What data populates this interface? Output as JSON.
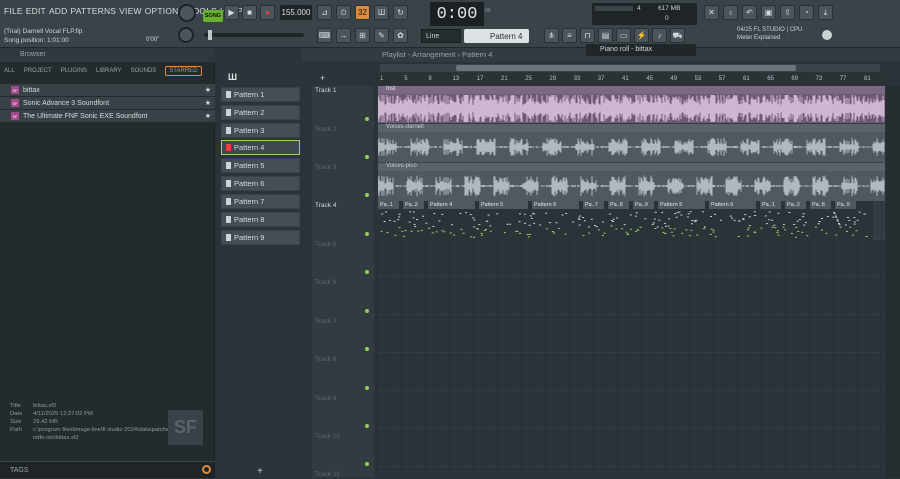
{
  "menu": [
    "FILE",
    "EDIT",
    "ADD",
    "PATTERNS",
    "VIEW",
    "OPTIONS",
    "TOOLS",
    "HELP"
  ],
  "transport": {
    "song_label": "SONG",
    "tempo": "155.000",
    "time": "0:00",
    "time_sub": "00",
    "pattern_counter": "32"
  },
  "status": {
    "title": "(Trial) Darnell Vocal FLP.flp",
    "song_position": "Song position: 1:01:00",
    "pos_small": "0'00\""
  },
  "cpu": {
    "voices": "4",
    "mem": "617 MB",
    "zero": "0"
  },
  "fl_info": {
    "line1": "04/25  FL STUDIO | CPU",
    "line2": "Meter Explained"
  },
  "tool": {
    "line": "Line",
    "pattern": "Pattern 4"
  },
  "browser": {
    "title": "Browser",
    "tabs": [
      "ALL",
      "PROJECT",
      "PLUGINS",
      "LIBRARY",
      "SOUNDS",
      "STARRED"
    ],
    "items": [
      {
        "label": "bittax",
        "icon": "SF"
      },
      {
        "label": "Sonic Advance 3 Soundfont",
        "icon": "SF"
      },
      {
        "label": "The Ultimate FNF Sonic EXE Soundfont",
        "icon": "SF"
      }
    ],
    "meta": {
      "title_k": "Title",
      "title": "bittax.sf2",
      "date_k": "Date",
      "date": "4/11/2025 12:27:02 PM",
      "size_k": "Size",
      "size": "29.42 MB",
      "path_k": "Path",
      "path": "c:\\program files\\image-line\\fl studio 2024\\data\\patches\\soundfo-nts\\bittax.sf2"
    },
    "logo": "SF",
    "tags": "TAGS"
  },
  "patterns": [
    "Pattern 1",
    "Pattern 2",
    "Pattern 3",
    "Pattern 4",
    "Pattern 5",
    "Pattern 6",
    "Pattern 7",
    "Pattern 8",
    "Pattern 9"
  ],
  "playlist": {
    "title": "Playlist - Arrangement › Pattern 4",
    "piano_roll": "Piano roll - bittax",
    "add": "+",
    "pattern_add": "+"
  },
  "tracks": [
    "Track 1",
    "Track 2",
    "Track 3",
    "Track 4",
    "Track 5",
    "Track 6",
    "Track 7",
    "Track 8",
    "Track 9",
    "Track 10",
    "Track 11"
  ],
  "ruler": [
    "1",
    "5",
    "9",
    "13",
    "17",
    "21",
    "25",
    "29",
    "33",
    "37",
    "41",
    "45",
    "49",
    "53",
    "57",
    "61",
    "65",
    "69",
    "73",
    "77",
    "81"
  ],
  "clips": {
    "inst": "Inst",
    "voices_darnell": "Voices-darnell",
    "voices_pico": "Voices-pico"
  },
  "pattern_clips": [
    "Pa..1",
    "Pa..2",
    "Pattern 4",
    "Pattern 5",
    "Pattern 6",
    "Pa..7",
    "Pa..8",
    "Pa..9",
    "Pattern 5",
    "Pattern 6",
    "Pa..1",
    "Pa..2",
    "Pa..8",
    "Pa..9"
  ]
}
